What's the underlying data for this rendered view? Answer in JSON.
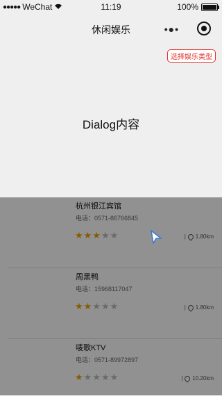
{
  "status_bar": {
    "carrier": "WeChat",
    "time": "11:19",
    "battery": "100%"
  },
  "nav": {
    "title": "休闲娱乐",
    "more_icon": "more-icon",
    "close_icon": "close-icon"
  },
  "dialog": {
    "type_button": "选择娱乐类型",
    "content": "Dialog内容"
  },
  "list": [
    {
      "name": "杭州银江宾馆",
      "phone": "电话：0571-86766845",
      "rating": 3,
      "max": 5,
      "distance": "1.80km"
    },
    {
      "name": "周黑鸭",
      "phone": "电话：15968117047",
      "rating": 2,
      "max": 5,
      "distance": "1.80km"
    },
    {
      "name": "唛歌KTV",
      "phone": "电话：0571-89972897",
      "rating": 1,
      "max": 5,
      "distance": "10.20km"
    }
  ],
  "colors": {
    "accent": "#e0332c",
    "star": "#f0a000",
    "mask": "rgba(0,0,0,0.43)"
  }
}
